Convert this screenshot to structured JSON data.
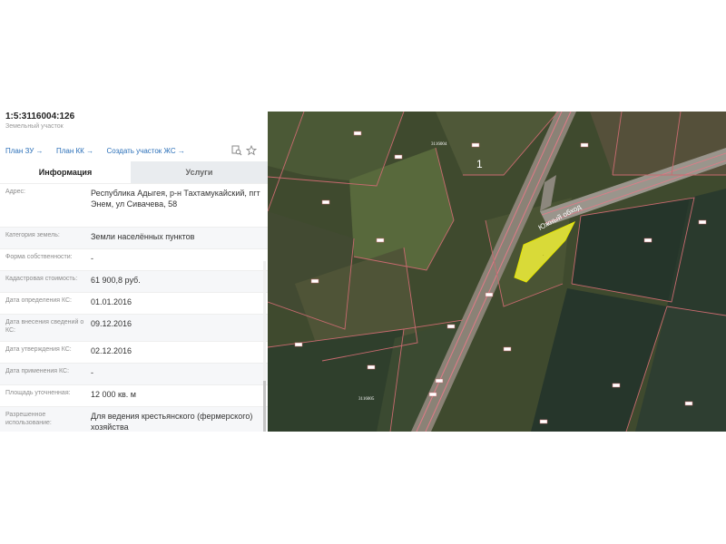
{
  "parcel": {
    "cadastral_number": "1:5:3116004:126",
    "object_type": "Земельный участок"
  },
  "links": [
    "План ЗУ →",
    "План КК →",
    "Создать участок ЖС →"
  ],
  "tabs": {
    "info": "Информация",
    "services": "Услуги"
  },
  "rows": [
    {
      "label": "Адрес:",
      "value": "Республика Адыгея, р-н Тахтамукайский, пгт Энем, ул Сивачева, 58"
    },
    {
      "label": "Категория земель:",
      "value": "Земли населённых пунктов"
    },
    {
      "label": "Форма собственности:",
      "value": "-"
    },
    {
      "label": "Кадастровая стоимость:",
      "value": "61 900,8 руб."
    },
    {
      "label": "Дата определения КС:",
      "value": "01.01.2016"
    },
    {
      "label": "Дата внесения сведений о КС:",
      "value": "09.12.2016"
    },
    {
      "label": "Дата утверждения КС:",
      "value": "02.12.2016"
    },
    {
      "label": "Дата применения КС:",
      "value": "-"
    },
    {
      "label": "Площадь уточненная:",
      "value": "12 000 кв. м"
    },
    {
      "label": "Разрешенное использование:",
      "value": "Для ведения крестьянского (фермерского) хозяйства"
    }
  ],
  "map": {
    "road_label": "Южный обход",
    "block_number": "1",
    "plot_labels": [
      "3116004",
      "3116005"
    ],
    "highlight_color": "#f2f23a"
  }
}
